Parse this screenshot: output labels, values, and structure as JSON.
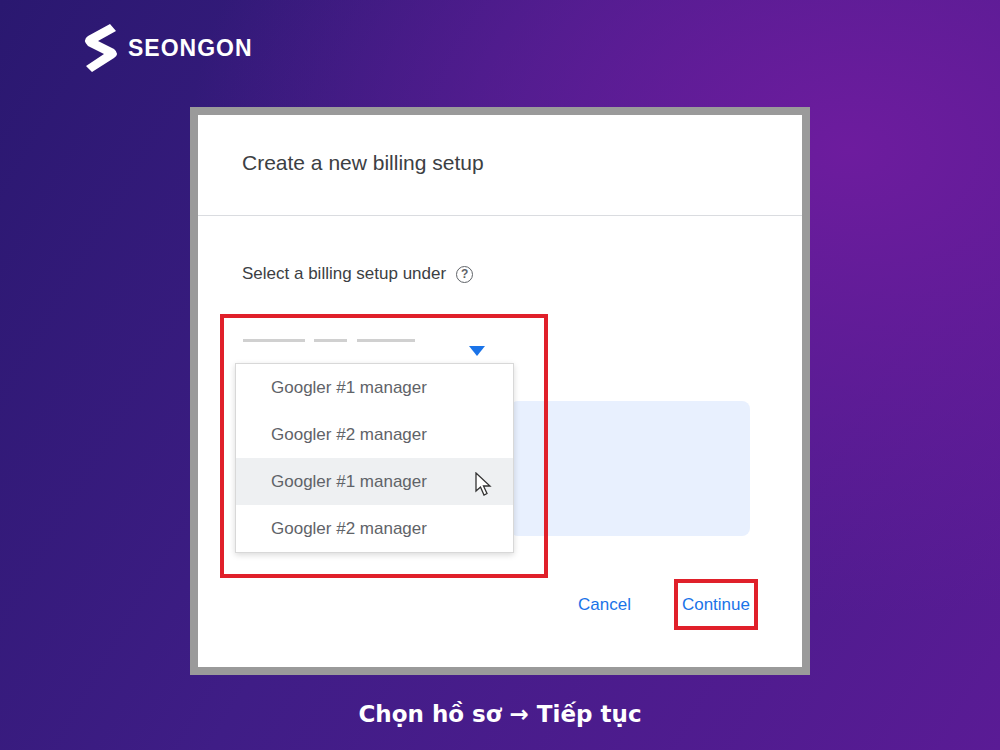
{
  "logo": {
    "text": "SEONGON"
  },
  "dialog": {
    "title": "Create a new billing setup",
    "label": "Select a billing setup under",
    "help": "?",
    "dropdown": {
      "expanded": true,
      "annotated": true,
      "options": [
        {
          "label": "Googler #1 manager",
          "selected": false
        },
        {
          "label": "Googler #2 manager",
          "selected": false
        },
        {
          "label": "Googler #1 manager",
          "selected": true
        },
        {
          "label": "Googler #2 manager",
          "selected": false
        }
      ]
    },
    "buttons": [
      {
        "label": "Cancel",
        "annotated": false
      },
      {
        "label": "Continue",
        "annotated": true
      }
    ]
  },
  "caption": "Chọn hồ sơ → Tiếp tục"
}
